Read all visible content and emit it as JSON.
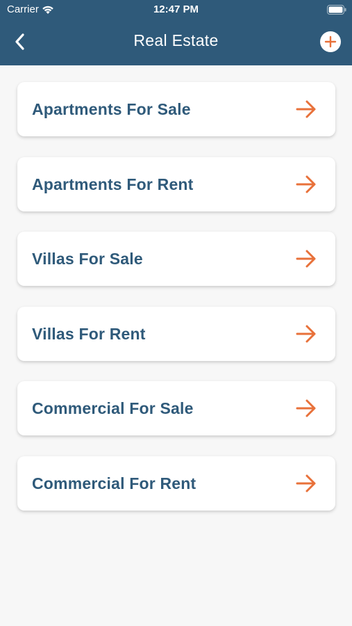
{
  "status_bar": {
    "carrier": "Carrier",
    "time": "12:47 PM",
    "icons": [
      "wifi-icon",
      "battery-icon"
    ]
  },
  "header": {
    "title": "Real Estate",
    "back_icon": "chevron-left-icon",
    "add_icon": "plus-circle-icon"
  },
  "colors": {
    "header_bg": "#2f5a7a",
    "label": "#2f5a7a",
    "arrow": "#e8713a",
    "background": "#f7f7f7"
  },
  "categories": [
    {
      "label": "Apartments For Sale",
      "icon": "arrow-right-icon"
    },
    {
      "label": "Apartments For Rent",
      "icon": "arrow-right-icon"
    },
    {
      "label": "Villas For Sale",
      "icon": "arrow-right-icon"
    },
    {
      "label": "Villas For Rent",
      "icon": "arrow-right-icon"
    },
    {
      "label": "Commercial For Sale",
      "icon": "arrow-right-icon"
    },
    {
      "label": "Commercial For Rent",
      "icon": "arrow-right-icon"
    }
  ]
}
